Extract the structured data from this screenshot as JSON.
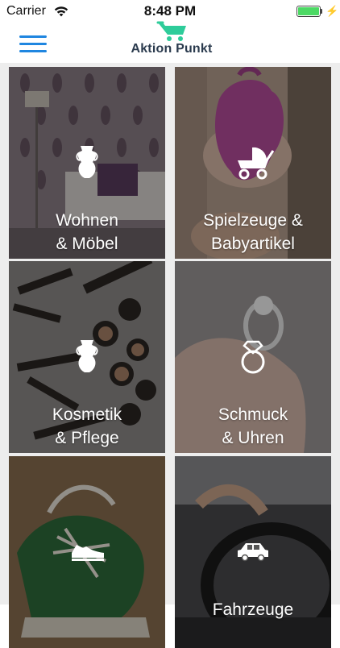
{
  "status_bar": {
    "carrier": "Carrier",
    "time": "8:48 PM",
    "battery_level": 1.0,
    "battery_color": "#4cd964"
  },
  "nav": {
    "menu_icon": "hamburger-icon",
    "logo_text": "Aktion Punkt",
    "accent_color": "#1f86e0",
    "logo_color": "#2ecc9a"
  },
  "categories": [
    {
      "line1": "Wohnen",
      "line2": "& Möbel",
      "icon": "vase-icon"
    },
    {
      "line1": "Spielzeuge &",
      "line2": "Babyartikel",
      "icon": "stroller-icon"
    },
    {
      "line1": "Kosmetik",
      "line2": "& Pflege",
      "icon": "vase-icon"
    },
    {
      "line1": "Schmuck",
      "line2": "& Uhren",
      "icon": "ring-icon"
    },
    {
      "line1": "",
      "line2": "",
      "icon": "sneaker-icon"
    },
    {
      "line1": "Fahrzeuge",
      "line2": "",
      "icon": "car-icon"
    }
  ]
}
